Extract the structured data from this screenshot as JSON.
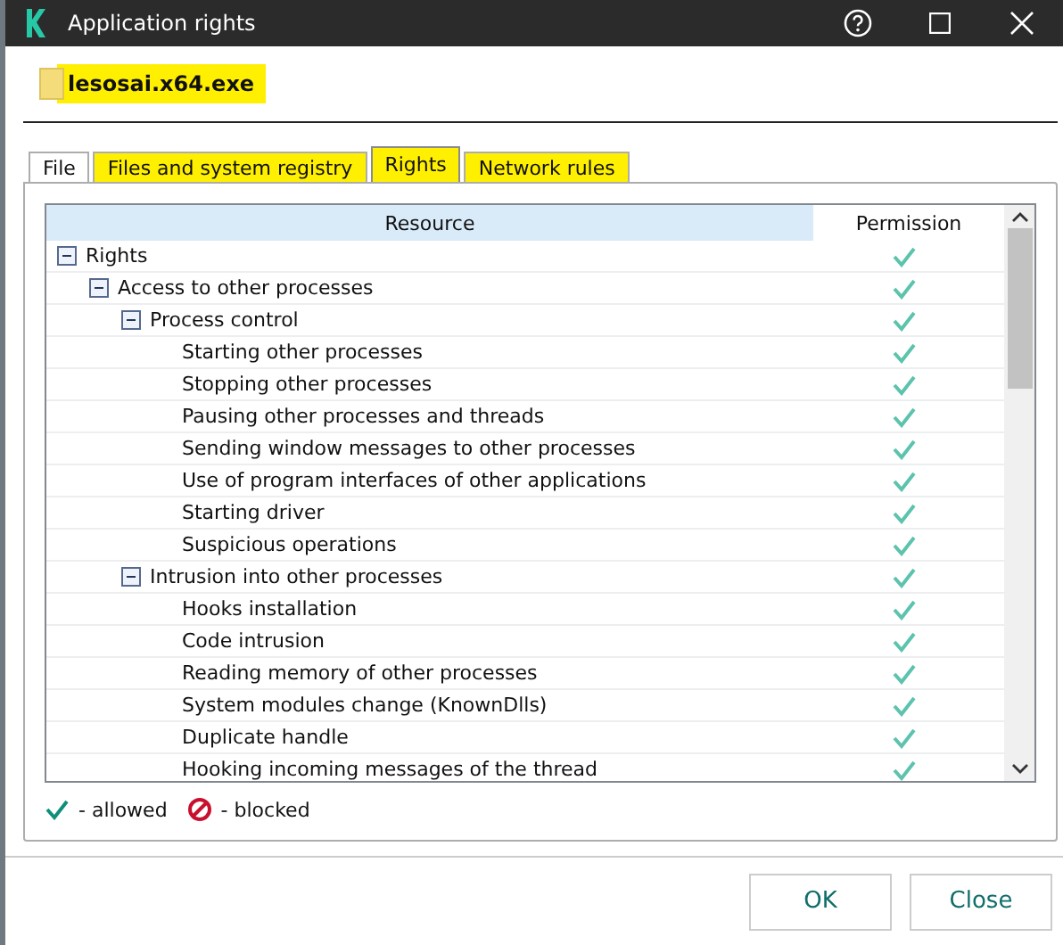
{
  "window": {
    "title": "Application rights"
  },
  "file": {
    "name": "lesosai.x64.exe",
    "highlighted": true
  },
  "tabs": [
    {
      "label": "File",
      "selected": false,
      "highlighted": false
    },
    {
      "label": "Files and system registry",
      "selected": false,
      "highlighted": true
    },
    {
      "label": "Rights",
      "selected": true,
      "highlighted": true
    },
    {
      "label": "Network rules",
      "selected": false,
      "highlighted": true
    }
  ],
  "table": {
    "columns": [
      "Resource",
      "Permission"
    ],
    "rows": [
      {
        "label": "Rights",
        "allowed": true,
        "expanded": true,
        "children": [
          {
            "label": "Access to other processes",
            "allowed": true,
            "expanded": true,
            "children": [
              {
                "label": "Process control",
                "allowed": true,
                "expanded": true,
                "children": [
                  {
                    "label": "Starting other processes",
                    "allowed": true
                  },
                  {
                    "label": "Stopping other processes",
                    "allowed": true
                  },
                  {
                    "label": "Pausing other processes and threads",
                    "allowed": true
                  },
                  {
                    "label": "Sending window messages to other processes",
                    "allowed": true
                  },
                  {
                    "label": "Use of program interfaces of other applications",
                    "allowed": true
                  },
                  {
                    "label": "Starting driver",
                    "allowed": true
                  },
                  {
                    "label": "Suspicious operations",
                    "allowed": true
                  }
                ]
              },
              {
                "label": "Intrusion into other processes",
                "allowed": true,
                "expanded": true,
                "children": [
                  {
                    "label": "Hooks installation",
                    "allowed": true
                  },
                  {
                    "label": "Code intrusion",
                    "allowed": true
                  },
                  {
                    "label": "Reading memory of other processes",
                    "allowed": true
                  },
                  {
                    "label": "System modules change (KnownDlls)",
                    "allowed": true
                  },
                  {
                    "label": "Duplicate handle",
                    "allowed": true
                  },
                  {
                    "label": "Hooking incoming messages of the thread",
                    "allowed": true
                  }
                ]
              }
            ]
          }
        ]
      }
    ]
  },
  "legend": [
    {
      "kind": "allowed",
      "label": "- allowed"
    },
    {
      "kind": "blocked",
      "label": "- blocked"
    }
  ],
  "buttons": [
    "OK",
    "Close"
  ]
}
